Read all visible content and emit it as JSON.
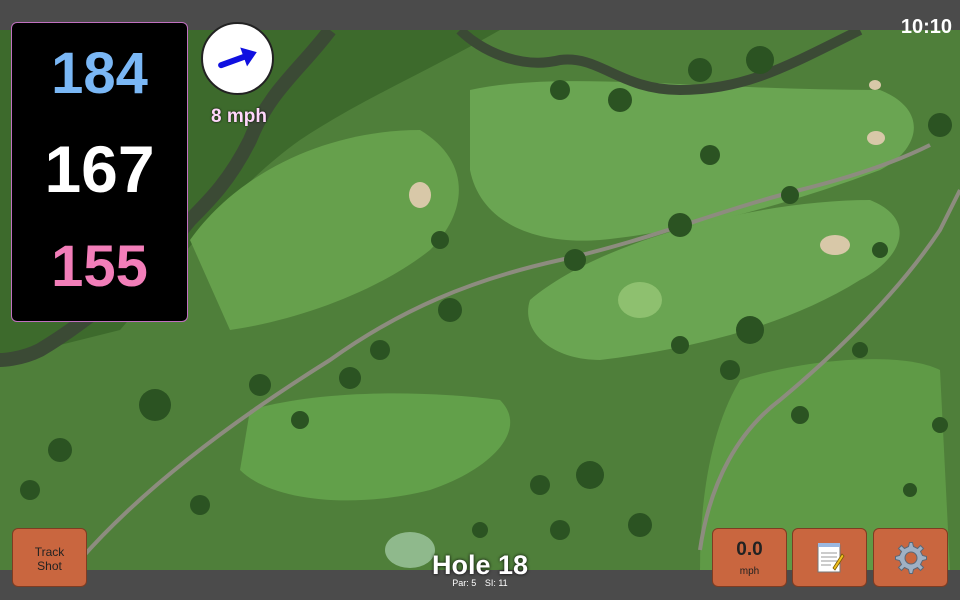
{
  "status_bar": {
    "time": "10:10"
  },
  "distances": {
    "back": "184",
    "middle": "167",
    "front": "155"
  },
  "wind": {
    "speed_label": "8 mph",
    "direction_icon": "wind-arrow-icon"
  },
  "buttons": {
    "track_shot_line1": "Track",
    "track_shot_line2": "Shot",
    "speed_value": "0.0",
    "speed_unit": "mph",
    "notes_icon": "notepad-icon",
    "settings_icon": "gear-icon"
  },
  "hole": {
    "title": "Hole 18",
    "par": "Par: 5",
    "si": "SI: 11"
  },
  "colors": {
    "back_distance": "#7ab7f5",
    "middle_distance": "#ffffff",
    "front_distance": "#f27eb9",
    "button_bg": "#c9663f",
    "bar_bg": "#4b4b4b"
  }
}
